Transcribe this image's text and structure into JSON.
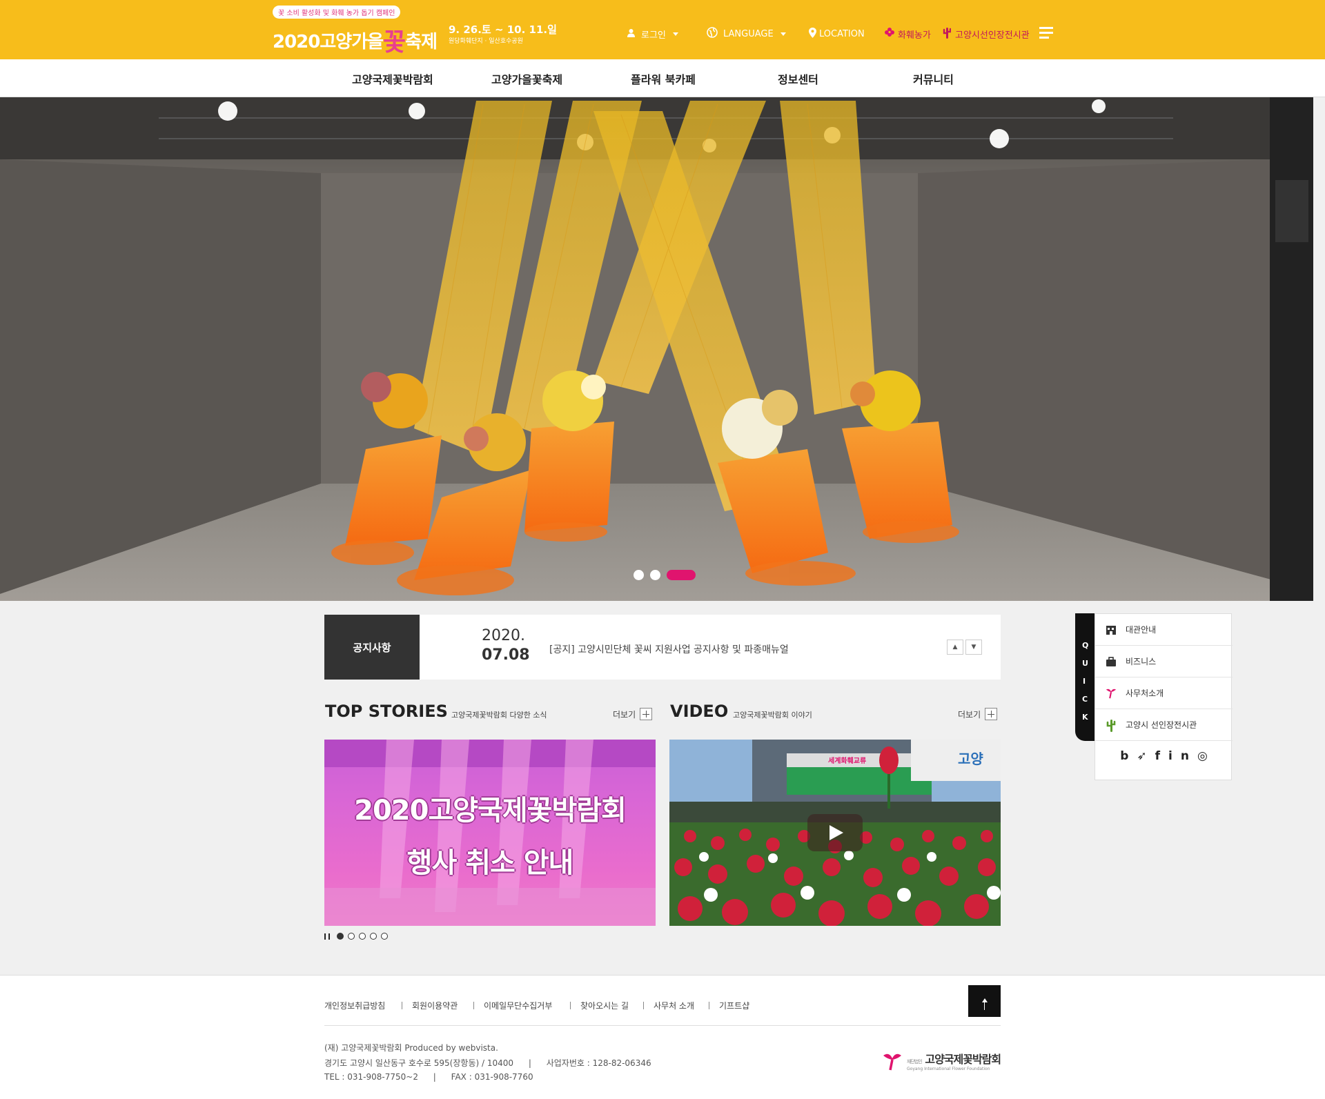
{
  "header": {
    "tagline": "꽃 소비 활성화 및 화훼 농가 돕기 캠페인",
    "title_pre": "2020고양가을",
    "title_flower": "꽃",
    "title_post": "축제",
    "date": "9. 26.토 ~ 10. 11.일",
    "place": "원당화훼단지 · 일산호수공원",
    "login": "로그인",
    "language": "LANGUAGE",
    "location": "LOCATION",
    "flower_farm": "화훼농가",
    "cactus_hall": "고양시선인장전시관",
    "accent_color": "#f7bd1b"
  },
  "gnb": [
    "고양국제꽃박람회",
    "고양가을꽃축제",
    "플라워 북카페",
    "정보센터",
    "커뮤니티"
  ],
  "hero": {
    "slides": 3,
    "active_slide": 3,
    "active_color": "#e0146e"
  },
  "notice": {
    "label": "공지사항",
    "year": "2020.",
    "date": "07.08",
    "text": "[공지] 고양시민단체 꽃씨 지원사업 공지사항 및 파종매뉴얼"
  },
  "top_stories": {
    "title": "TOP STORIES",
    "subtitle": "고양국제꽃박람회 다양한 소식",
    "more": "더보기",
    "banner_line1": "2020고양국제꽃박람회",
    "banner_line2": "행사 취소 안내",
    "dots": 5,
    "active_dot": 1
  },
  "video": {
    "title": "VIDEO",
    "subtitle": "고양국제꽃박람회 이야기",
    "more": "더보기",
    "sign_text": "세계화훼교류",
    "sign_logo": "고양"
  },
  "quick": {
    "tab_letters": [
      "Q",
      "U",
      "I",
      "C",
      "K"
    ],
    "items": [
      {
        "label": "대관안내",
        "icon": "building-icon"
      },
      {
        "label": "비즈니스",
        "icon": "briefcase-icon"
      },
      {
        "label": "사무처소개",
        "icon": "foundation-logo-icon"
      },
      {
        "label": "고양시 선인장전시관",
        "icon": "cactus-icon"
      }
    ],
    "social": [
      "b",
      "twitter",
      "f",
      "in",
      "weibo"
    ]
  },
  "footer": {
    "links": [
      "개인정보취급방침",
      "회원이용약관",
      "이메일무단수집거부",
      "찾아오시는 길",
      "사무처 소개",
      "기프트샵"
    ],
    "org": "(재) 고양국제꽃박람회 Produced by webvista.",
    "address": "경기도 고양시 일산동구 호수로 595(장항동) / 10400",
    "biz_no": "사업자번호 : 128-82-06346",
    "tel": "TEL : 031-908-7750~2",
    "fax": "FAX : 031-908-7760",
    "logo_text": "고양국제꽃박람회",
    "logo_prefix": "재단법인",
    "logo_sub": "Goyang International Flower Foundation"
  }
}
